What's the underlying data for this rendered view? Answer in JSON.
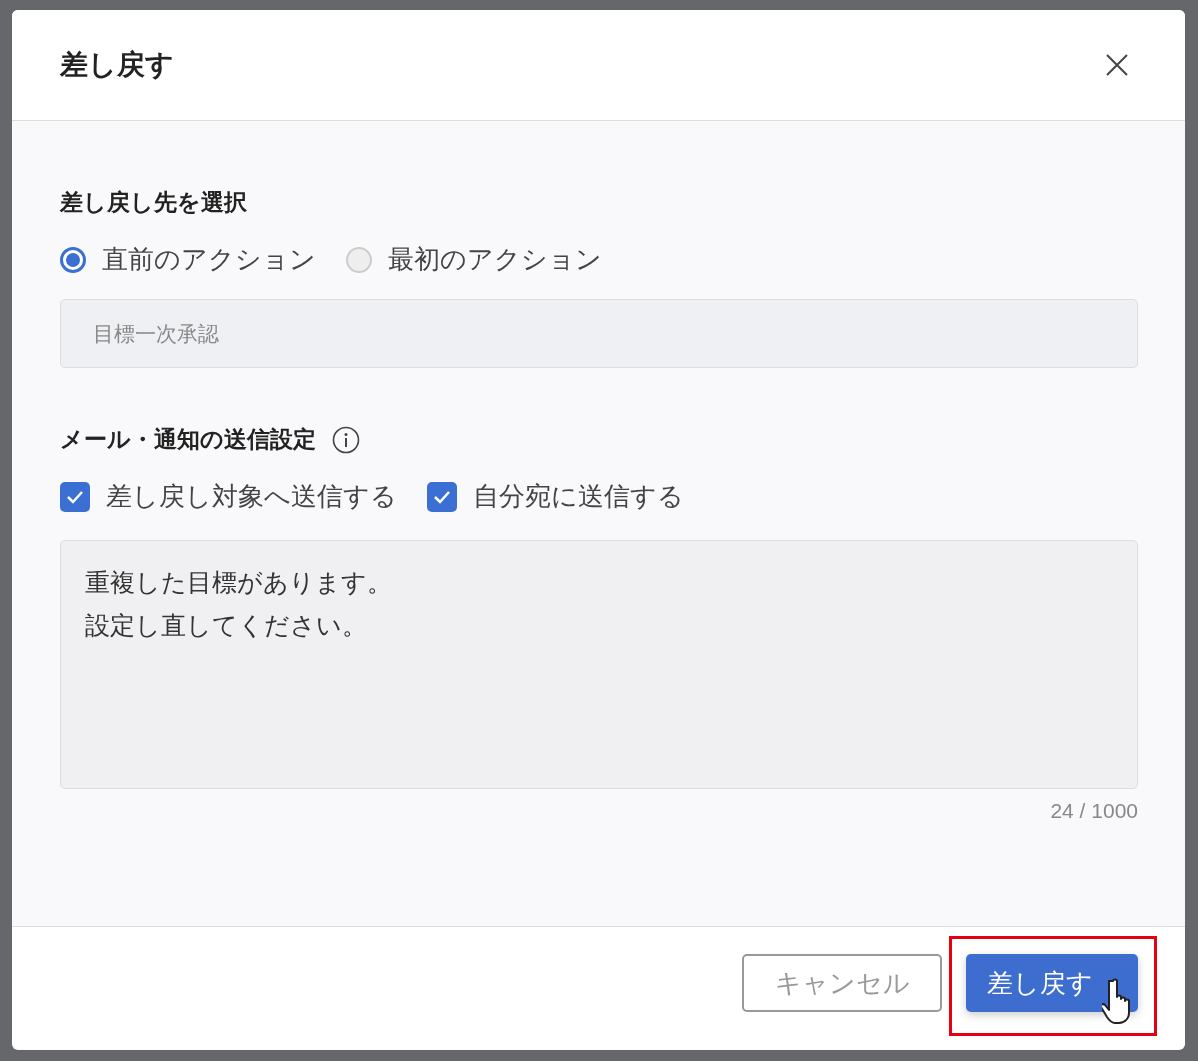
{
  "dialog": {
    "title": "差し戻す"
  },
  "destination": {
    "heading": "差し戻し先を選択",
    "options": [
      {
        "label": "直前のアクション",
        "selected": true
      },
      {
        "label": "最初のアクション",
        "selected": false
      }
    ],
    "field": {
      "value": "目標一次承認"
    }
  },
  "notification": {
    "heading": "メール・通知の送信設定",
    "options": [
      {
        "label": "差し戻し対象へ送信する",
        "checked": true
      },
      {
        "label": "自分宛に送信する",
        "checked": true
      }
    ],
    "message": {
      "lines": [
        "重複した目標があります。",
        "設定し直してください。"
      ]
    },
    "counter": "24 / 1000"
  },
  "buttons": [
    {
      "label": "キャンセル",
      "kind": "secondary",
      "highlighted": false
    },
    {
      "label": "差し戻す",
      "kind": "primary",
      "highlighted": true
    }
  ]
}
